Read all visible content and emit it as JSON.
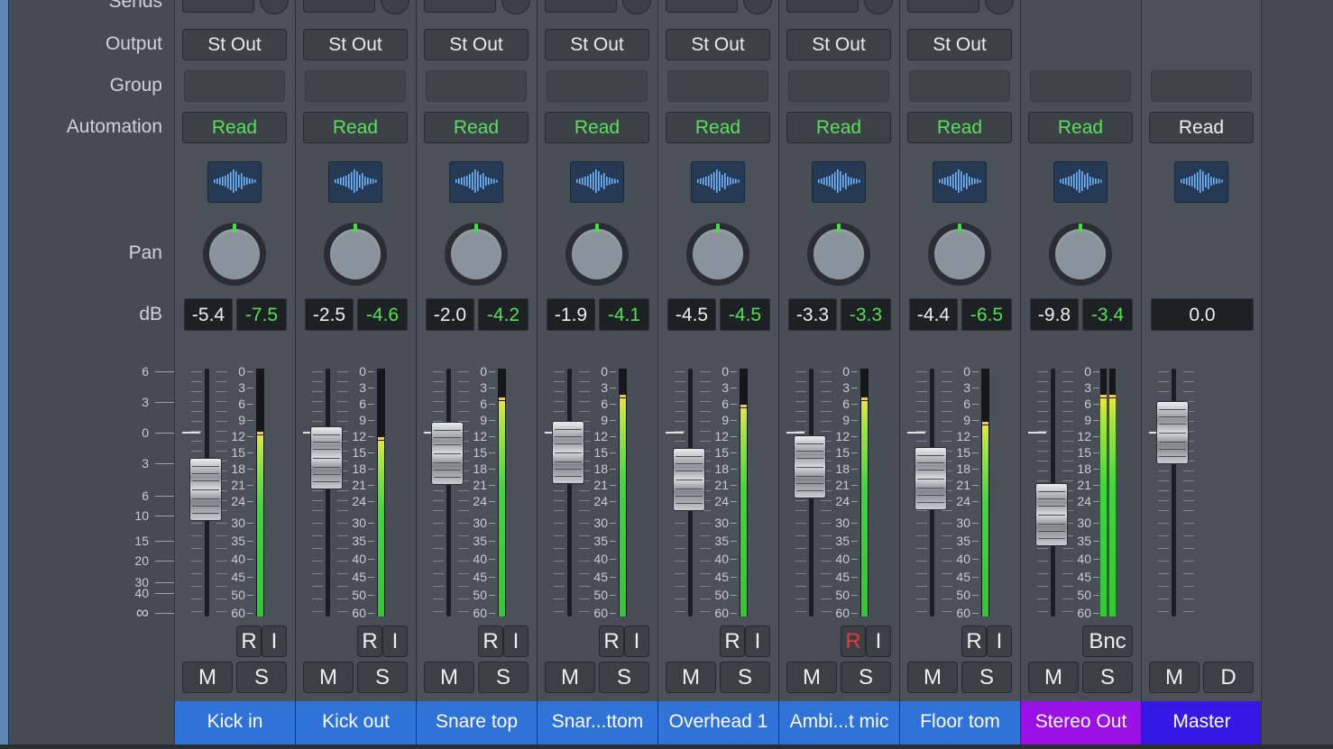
{
  "labels": {
    "sends": "Sends",
    "output": "Output",
    "group": "Group",
    "automation": "Automation",
    "pan": "Pan",
    "db": "dB"
  },
  "scale_left": [
    "6",
    "3",
    "0",
    "3",
    "6",
    "10",
    "15",
    "20",
    "30",
    "40",
    "∞"
  ],
  "meter_scale": [
    "0",
    "3",
    "6",
    "9",
    "12",
    "15",
    "18",
    "21",
    "24",
    "30",
    "35",
    "40",
    "45",
    "50",
    "60"
  ],
  "colors": {
    "channel_blue": "#2f73d8",
    "stereo_purple": "#9b10e4",
    "master_indigo": "#3419e6",
    "read_green": "#57e05a"
  },
  "channels": [
    {
      "name": "Kick in",
      "output": "St Out",
      "automation": "Read",
      "volume": "-5.4",
      "peak": "-7.5",
      "r": "R",
      "i": "I",
      "mute": "M",
      "solo": "S",
      "meter_level": 0.73,
      "fader_db": -5.4
    },
    {
      "name": "Kick out",
      "output": "St Out",
      "automation": "Read",
      "volume": "-2.5",
      "peak": "-4.6",
      "r": "R",
      "i": "I",
      "mute": "M",
      "solo": "S",
      "meter_level": 0.71,
      "fader_db": -2.5
    },
    {
      "name": "Snare top",
      "output": "St Out",
      "automation": "Read",
      "volume": "-2.0",
      "peak": "-4.2",
      "r": "R",
      "i": "I",
      "mute": "M",
      "solo": "S",
      "meter_level": 0.87,
      "fader_db": -2.0
    },
    {
      "name": "Snar...ttom",
      "output": "St Out",
      "automation": "Read",
      "volume": "-1.9",
      "peak": "-4.1",
      "r": "R",
      "i": "I",
      "mute": "M",
      "solo": "S",
      "meter_level": 0.88,
      "fader_db": -1.9
    },
    {
      "name": "Overhead 1",
      "output": "St Out",
      "automation": "Read",
      "volume": "-4.5",
      "peak": "-4.5",
      "r": "R",
      "i": "I",
      "mute": "M",
      "solo": "S",
      "meter_level": 0.84,
      "fader_db": -4.5
    },
    {
      "name": "Ambi...t mic",
      "output": "St Out",
      "automation": "Read",
      "volume": "-3.3",
      "peak": "-3.3",
      "r": "R",
      "i": "I",
      "mute": "M",
      "solo": "S",
      "meter_level": 0.87,
      "fader_db": -3.3
    },
    {
      "name": "Floor tom",
      "output": "St Out",
      "automation": "Read",
      "volume": "-4.4",
      "peak": "-6.5",
      "r": "R",
      "i": "I",
      "mute": "M",
      "solo": "S",
      "meter_level": 0.77,
      "fader_db": -4.4
    },
    {
      "name": "Stereo Out",
      "output": "",
      "automation": "Read",
      "volume": "-9.8",
      "peak": "-3.4",
      "bnc": "Bnc",
      "mute": "M",
      "solo": "S",
      "meter_level": 0.88,
      "fader_db": -9.8
    },
    {
      "name": "Master",
      "output": "",
      "automation": "Read",
      "volume": "0.0",
      "mute": "M",
      "dim": "D",
      "fader_db": 0.0
    }
  ]
}
